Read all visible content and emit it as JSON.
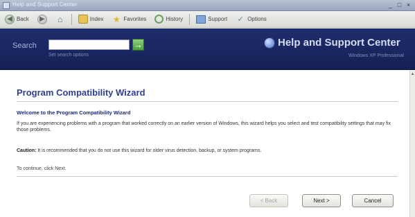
{
  "window": {
    "title": "Help and Support Center"
  },
  "window_controls": {
    "minimize": "_",
    "maximize": "□",
    "close": "×"
  },
  "toolbar": {
    "back_label": "Back",
    "index_label": "Index",
    "favorites_label": "Favorites",
    "history_label": "History",
    "support_label": "Support",
    "options_label": "Options"
  },
  "header": {
    "search_label": "Search",
    "search_value": "",
    "search_go": "→",
    "set_search_options": "Set search options",
    "help_title": "Help and Support Center",
    "help_subtitle": "Windows XP Professional"
  },
  "wizard": {
    "title": "Program Compatibility Wizard",
    "welcome_heading": "Welcome to the Program Compatibility Wizard",
    "intro": "If you are experiencing problems with a program that worked correctly on an earlier version of Windows, this wizard helps you select and test compatibility settings that may fix those problems.",
    "caution_label": "Caution:",
    "caution_text": " It is recommended that you do not use this wizard for older virus detection, backup, or system programs.",
    "continue_text": "To continue, click Next."
  },
  "buttons": {
    "back": "< Back",
    "next": "Next >",
    "cancel": "Cancel"
  }
}
